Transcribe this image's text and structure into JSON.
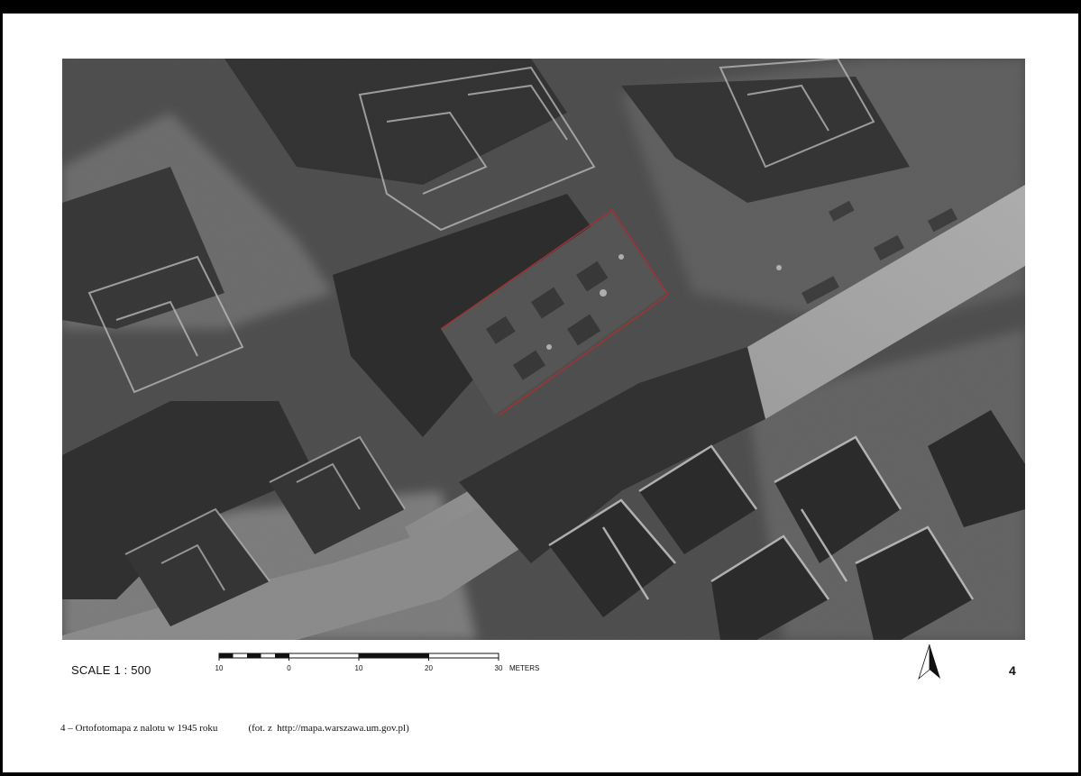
{
  "map": {
    "scale_label": "SCALE 1 : 500",
    "scalebar": {
      "ticks": [
        "10",
        "0",
        "10",
        "20",
        "30"
      ],
      "unit": "METERS"
    },
    "page_number": "4",
    "caption": "4 – Ortofotomapa z nalotu w 1945 roku",
    "credit": "(fot. z  http://mapa.warszawa.um.gov.pl)",
    "highlight_color": "#b02020",
    "north_arrow_icon": "north-arrow-icon"
  }
}
